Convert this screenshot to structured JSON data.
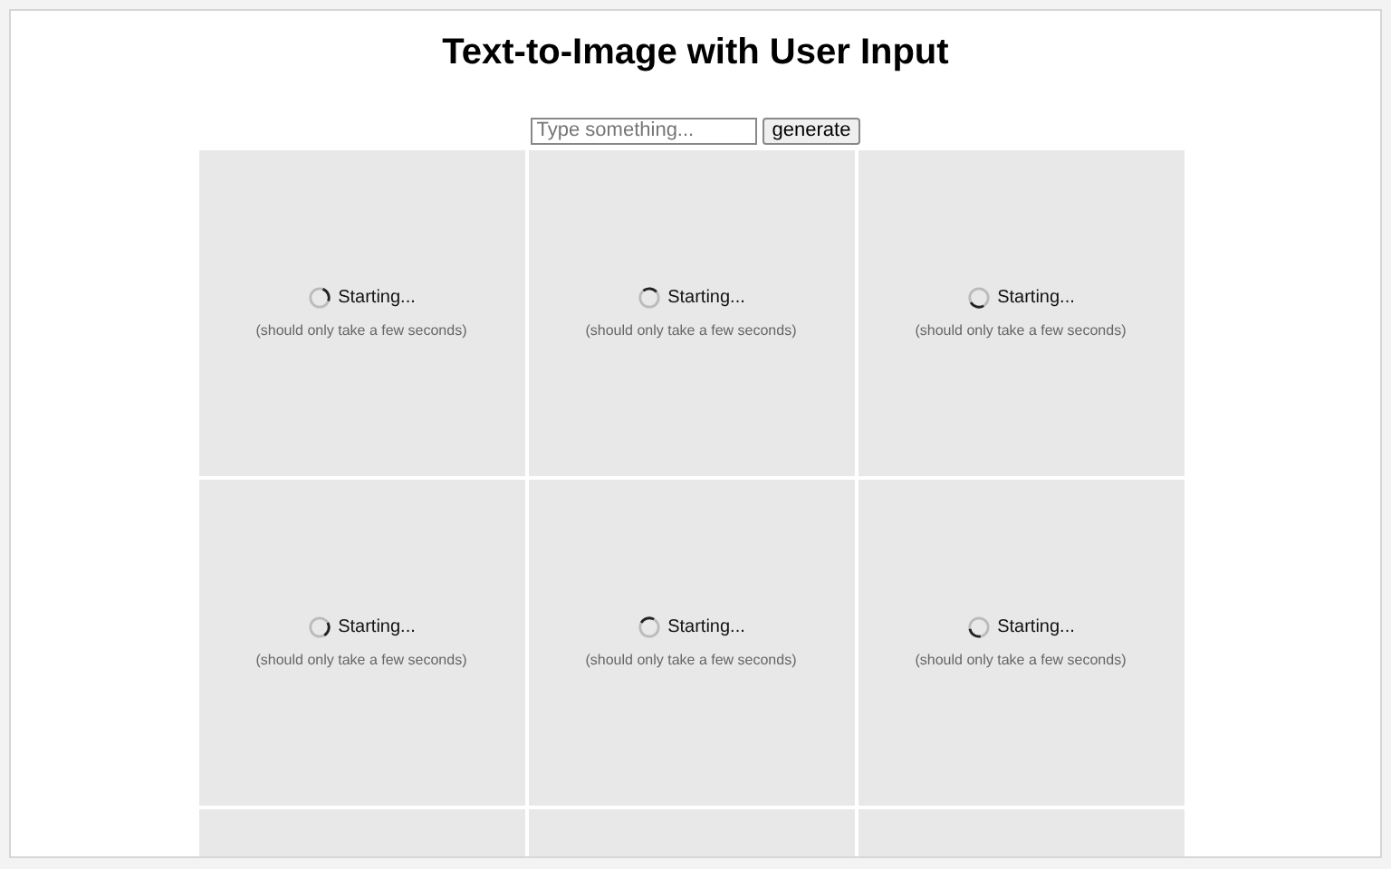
{
  "title": "Text-to-Image with User Input",
  "prompt": {
    "placeholder": "Type something...",
    "button": "generate"
  },
  "tiles": [
    {
      "kind": "loading",
      "status": "Starting...",
      "note": "(should only take a few seconds)"
    },
    {
      "kind": "loading",
      "status": "Starting...",
      "note": "(should only take a few seconds)"
    },
    {
      "kind": "loading",
      "status": "Starting...",
      "note": "(should only take a few seconds)"
    },
    {
      "kind": "loading",
      "status": "Starting...",
      "note": "(should only take a few seconds)"
    },
    {
      "kind": "loading",
      "status": "Starting...",
      "note": "(should only take a few seconds)"
    },
    {
      "kind": "loading",
      "status": "Starting...",
      "note": "(should only take a few seconds)"
    },
    {
      "kind": "blank"
    },
    {
      "kind": "blank"
    },
    {
      "kind": "blank"
    }
  ]
}
